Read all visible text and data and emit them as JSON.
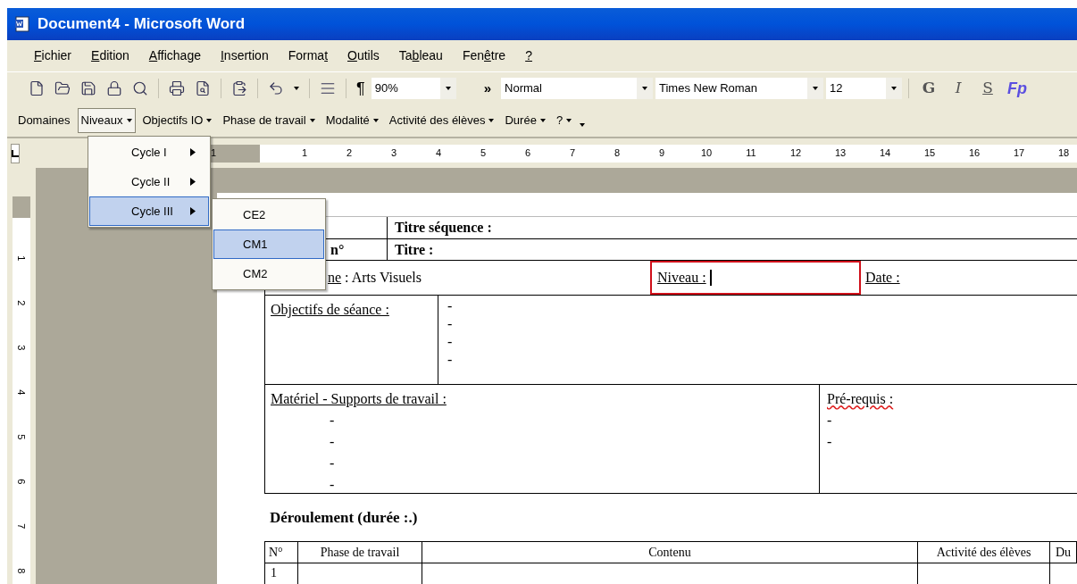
{
  "window": {
    "title": "Document4 - Microsoft Word"
  },
  "menu_bar": [
    {
      "key": "F",
      "after": "ichier"
    },
    {
      "key": "E",
      "after": "dition"
    },
    {
      "key": "A",
      "after": "ffichage"
    },
    {
      "key": "I",
      "after": "nsertion"
    },
    {
      "before": "Forma",
      "key": "t"
    },
    {
      "key": "O",
      "after": "utils"
    },
    {
      "before": "Ta",
      "key": "b",
      "after": "leau"
    },
    {
      "before": "Fen",
      "key": "ê",
      "after": "tre"
    },
    {
      "key": "?"
    }
  ],
  "standard_toolbar": {
    "marks_button": "¶",
    "zoom": "90%",
    "overflow": "»",
    "style": "Normal",
    "font": "Times New Roman",
    "size": "12",
    "format_buttons": [
      "G",
      "I",
      "S"
    ],
    "addin_button": "Fp"
  },
  "custom_toolbar": [
    {
      "label": "Domaines",
      "dropdown": false,
      "open": false
    },
    {
      "label": "Niveaux",
      "dropdown": true,
      "open": true
    },
    {
      "label": "Objectifs IO",
      "dropdown": true,
      "open": false
    },
    {
      "label": "Phase de travail",
      "dropdown": true,
      "open": false
    },
    {
      "label": "Modalité",
      "dropdown": true,
      "open": false
    },
    {
      "label": "Activité des élèves",
      "dropdown": true,
      "open": false
    },
    {
      "label": "Durée",
      "dropdown": true,
      "open": false
    },
    {
      "label": "?",
      "dropdown": true,
      "open": false
    }
  ],
  "niveaux_menu": [
    {
      "label": "Cycle I",
      "selected": false
    },
    {
      "label": "Cycle II",
      "selected": false
    },
    {
      "label": "Cycle III",
      "selected": true
    }
  ],
  "submenu": [
    {
      "label": "CE2",
      "selected": false
    },
    {
      "label": "CM1",
      "selected": true
    },
    {
      "label": "CM2",
      "selected": false
    }
  ],
  "ruler": {
    "left_mark": "1",
    "marks": [
      "1",
      "2",
      "3",
      "4",
      "5",
      "6",
      "7",
      "8",
      "9",
      "10",
      "11",
      "12",
      "13",
      "14",
      "15",
      "16",
      "17",
      "18"
    ]
  },
  "vertical_ruler": {
    "marks": [
      "1",
      "2",
      "3",
      "4",
      "5",
      "6",
      "7",
      "8"
    ]
  },
  "document": {
    "header_rows": [
      {
        "right": "Titre séquence :"
      },
      {
        "left": "n°",
        "right": "Titre :"
      }
    ],
    "domain_label": "ne",
    "domain_value": ": Arts Visuels",
    "level_label": "Niveau :",
    "level_highlighted": true,
    "date_label": "Date :",
    "objectives": {
      "label": "Objectifs de séance :",
      "items": [
        "-",
        "-",
        "-",
        "-"
      ]
    },
    "materials": {
      "label": "Matériel - Supports de travail :",
      "items": [
        "-",
        "-",
        "-",
        "-"
      ]
    },
    "prerequisites": {
      "label": "Pré-requis :",
      "misspelled": true,
      "items": [
        "-",
        "-"
      ]
    },
    "schedule": {
      "title": "Déroulement (durée :.)",
      "columns": [
        "N°",
        "Phase de travail",
        "Contenu",
        "Activité des élèves",
        "Du"
      ],
      "rows": [
        {
          "number": "1"
        }
      ]
    }
  }
}
